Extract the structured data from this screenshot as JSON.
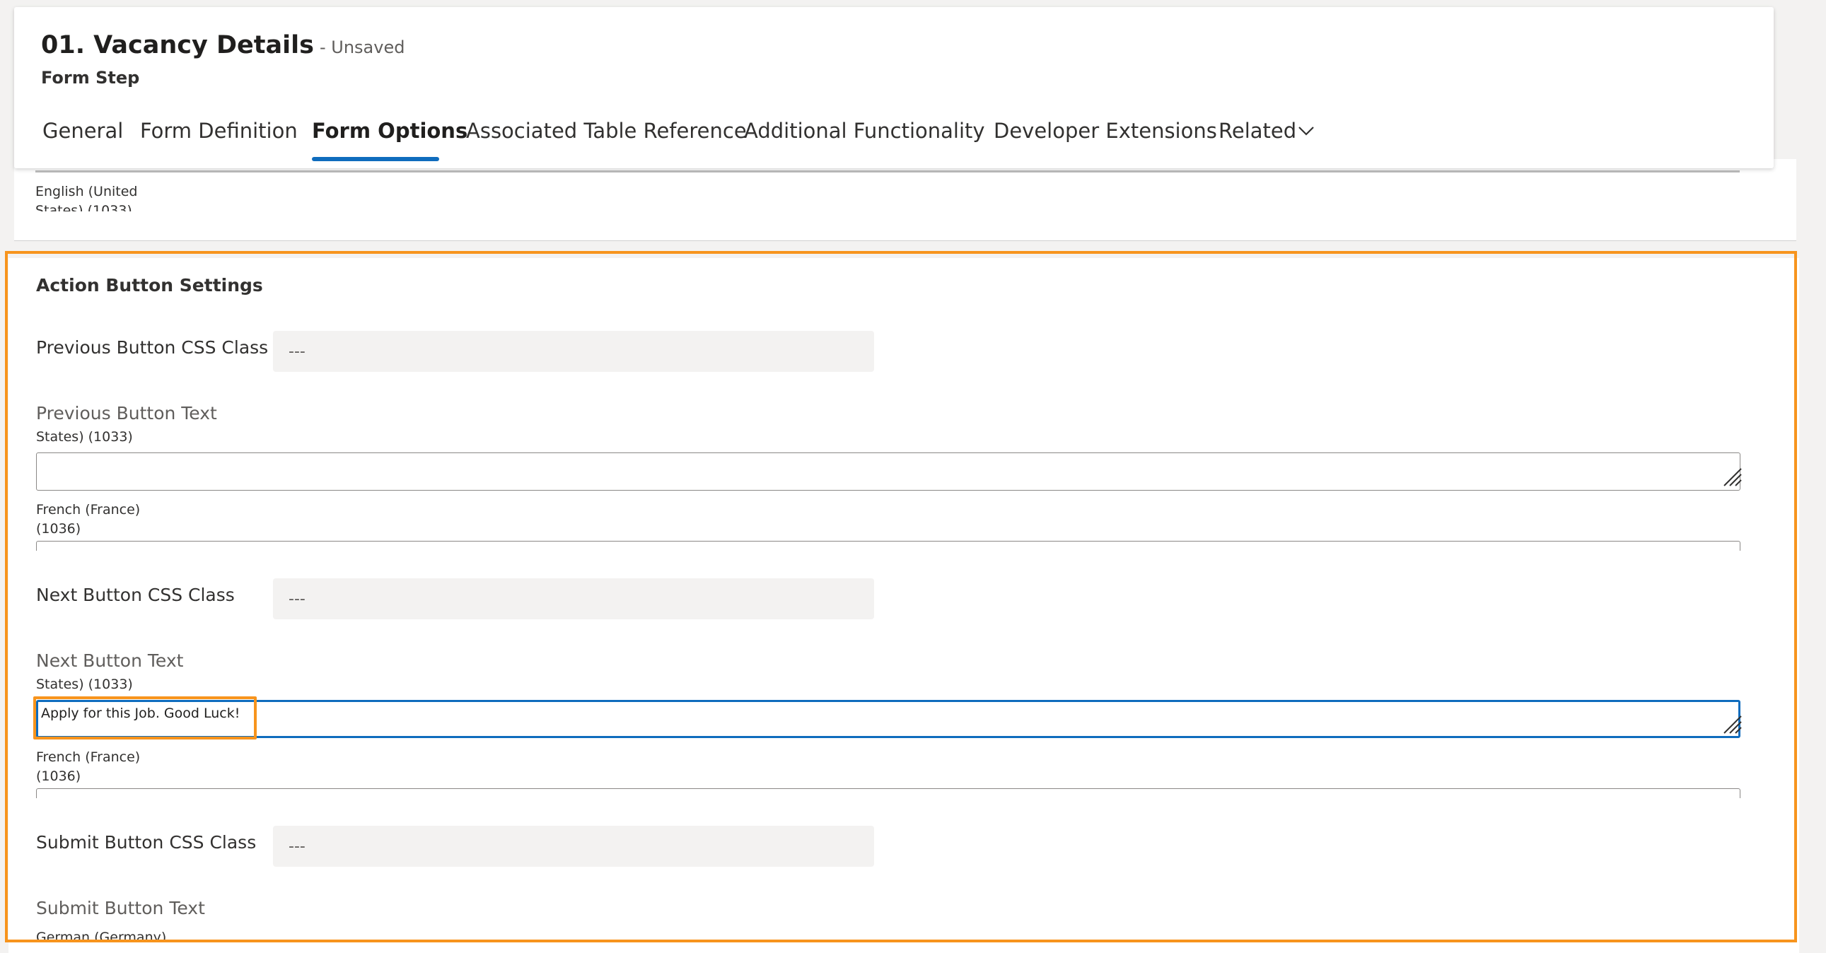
{
  "header": {
    "title": "01. Vacancy Details",
    "status": "- Unsaved",
    "subtitle": "Form Step"
  },
  "tabs": [
    {
      "label": "General"
    },
    {
      "label": "Form Definition"
    },
    {
      "label": "Form Options"
    },
    {
      "label": "Associated Table Reference"
    },
    {
      "label": "Additional Functionality"
    },
    {
      "label": "Developer Extensions"
    },
    {
      "label": "Related"
    }
  ],
  "active_tab": "Form Options",
  "upper": {
    "lang_line1": "English (United",
    "lang_line2": "States) (1033)"
  },
  "section": {
    "title": "Action Button Settings",
    "previous_css": {
      "label": "Previous Button CSS Class",
      "value": "---"
    },
    "previous_text": {
      "label": "Previous Button Text",
      "lang_en": "States) (1033)",
      "value": "",
      "lang_fr_line1": "French (France)",
      "lang_fr_line2": "(1036)"
    },
    "next_css": {
      "label": "Next Button CSS Class",
      "value": "---"
    },
    "next_text": {
      "label": "Next Button Text",
      "lang_en": "States) (1033)",
      "value": "Apply for this Job. Good Luck!",
      "lang_fr_line1": "French (France)",
      "lang_fr_line2": "(1036)"
    },
    "submit_css": {
      "label": "Submit Button CSS Class",
      "value": "---"
    },
    "submit_text": {
      "label": "Submit Button Text",
      "lang": "German (Germany)"
    }
  },
  "colors": {
    "accent": "#0f6cbd",
    "highlight": "#f7941d"
  },
  "icons": {
    "related_dropdown": "chevron-down-icon",
    "resize_handle": "resize-handle-icon"
  }
}
